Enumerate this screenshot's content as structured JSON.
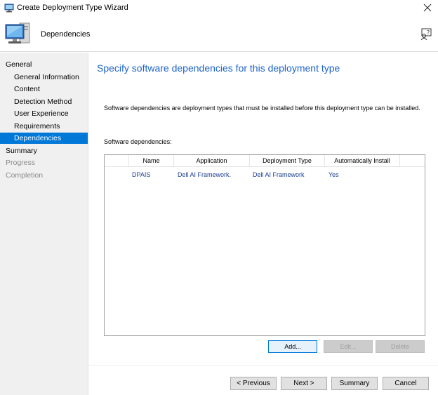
{
  "window": {
    "title": "Create Deployment Type Wizard"
  },
  "header": {
    "title": "Dependencies"
  },
  "sidebar": {
    "items": [
      {
        "label": "General",
        "level": "top",
        "state": "normal"
      },
      {
        "label": "General Information",
        "level": "sub",
        "state": "normal"
      },
      {
        "label": "Content",
        "level": "sub",
        "state": "normal"
      },
      {
        "label": "Detection Method",
        "level": "sub",
        "state": "normal"
      },
      {
        "label": "User Experience",
        "level": "sub",
        "state": "normal"
      },
      {
        "label": "Requirements",
        "level": "sub",
        "state": "normal"
      },
      {
        "label": "Dependencies",
        "level": "sub",
        "state": "selected"
      },
      {
        "label": "Summary",
        "level": "top",
        "state": "normal"
      },
      {
        "label": "Progress",
        "level": "top",
        "state": "disabled"
      },
      {
        "label": "Completion",
        "level": "top",
        "state": "disabled"
      }
    ]
  },
  "main": {
    "heading": "Specify software dependencies for this deployment type",
    "description": "Software dependencies are deployment types that must be installed before this deployment type can be installed.",
    "list_label": "Software dependencies:",
    "columns": [
      "",
      "Name",
      "Application",
      "Deployment Type",
      "Automatically Install"
    ],
    "rows": [
      {
        "name": "DPAIS",
        "application": "Dell AI Framework.",
        "deployment_type": "Dell AI Framework",
        "auto_install": "Yes"
      }
    ],
    "buttons": {
      "add": "Add...",
      "edit": "Edit...",
      "delete": "Delete"
    }
  },
  "footer": {
    "previous": "< Previous",
    "next": "Next >",
    "summary": "Summary",
    "cancel": "Cancel"
  },
  "colors": {
    "accent": "#0078d7",
    "heading": "#1e64c8",
    "row_text": "#1a3d8f",
    "sidebar_bg": "#f0f0f0"
  }
}
